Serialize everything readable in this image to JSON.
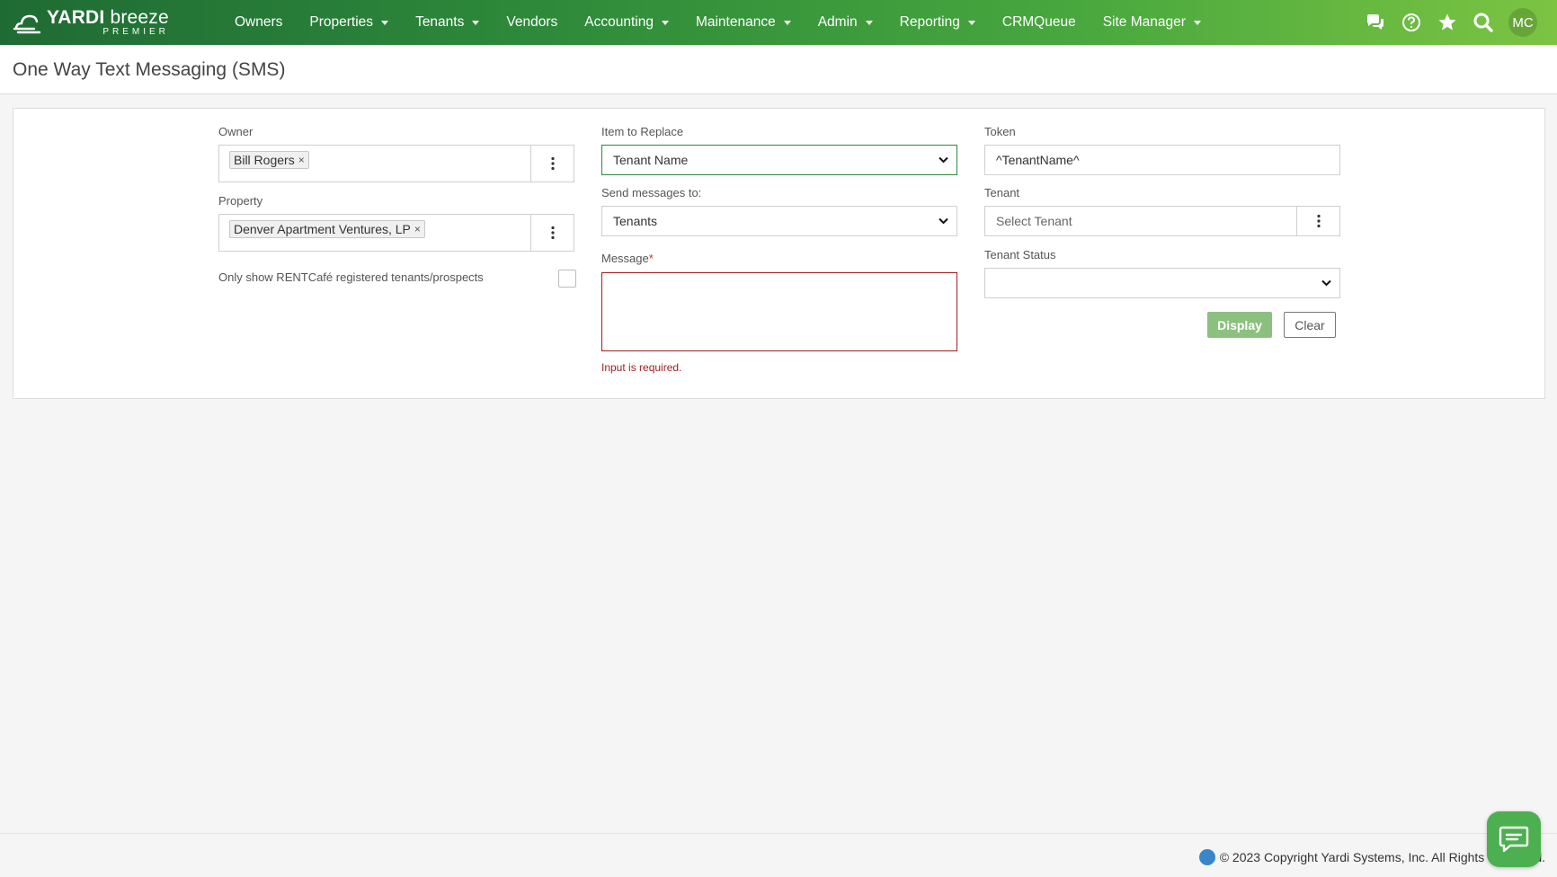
{
  "app": {
    "logo_main": "YARDI",
    "logo_main_2": "breeze",
    "logo_sub": "PREMIER"
  },
  "nav": {
    "items": [
      {
        "label": "Owners",
        "dropdown": false
      },
      {
        "label": "Properties",
        "dropdown": true
      },
      {
        "label": "Tenants",
        "dropdown": true
      },
      {
        "label": "Vendors",
        "dropdown": false
      },
      {
        "label": "Accounting",
        "dropdown": true
      },
      {
        "label": "Maintenance",
        "dropdown": true
      },
      {
        "label": "Admin",
        "dropdown": true
      },
      {
        "label": "Reporting",
        "dropdown": true
      },
      {
        "label": "CRMQueue",
        "dropdown": false
      },
      {
        "label": "Site Manager",
        "dropdown": true
      }
    ],
    "icons": [
      "chat-bubbles-icon",
      "help-circle-icon",
      "star-icon",
      "search-icon"
    ],
    "avatar_initials": "MC"
  },
  "page": {
    "title": "One Way Text Messaging (SMS)"
  },
  "form": {
    "owner": {
      "label": "Owner",
      "chip": "Bill Rogers",
      "chip_remove": "×"
    },
    "property": {
      "label": "Property",
      "chip": "Denver Apartment Ventures, LP",
      "chip_remove": "×"
    },
    "rentcafe": {
      "label": "Only show RENTCafé registered tenants/prospects",
      "checked": false
    },
    "item_to_replace": {
      "label": "Item to Replace",
      "value": "Tenant Name"
    },
    "send_to": {
      "label": "Send messages to:",
      "value": "Tenants"
    },
    "message": {
      "label": "Message",
      "required_mark": "*",
      "value": "",
      "error": "Input is required."
    },
    "token": {
      "label": "Token",
      "value": "^TenantName^"
    },
    "tenant": {
      "label": "Tenant",
      "placeholder": "Select Tenant"
    },
    "tenant_status": {
      "label": "Tenant Status",
      "value": ""
    },
    "buttons": {
      "display": "Display",
      "clear": "Clear"
    }
  },
  "footer": {
    "copyright": "© 2023 Copyright Yardi Systems, Inc. All Rights Reserved."
  },
  "colors": {
    "nav_start": "#1f6b34",
    "nav_end": "#7cc442",
    "accent_green": "#2e8a3a",
    "error_red": "#a11f1f",
    "display_button": "#8cc07f"
  }
}
